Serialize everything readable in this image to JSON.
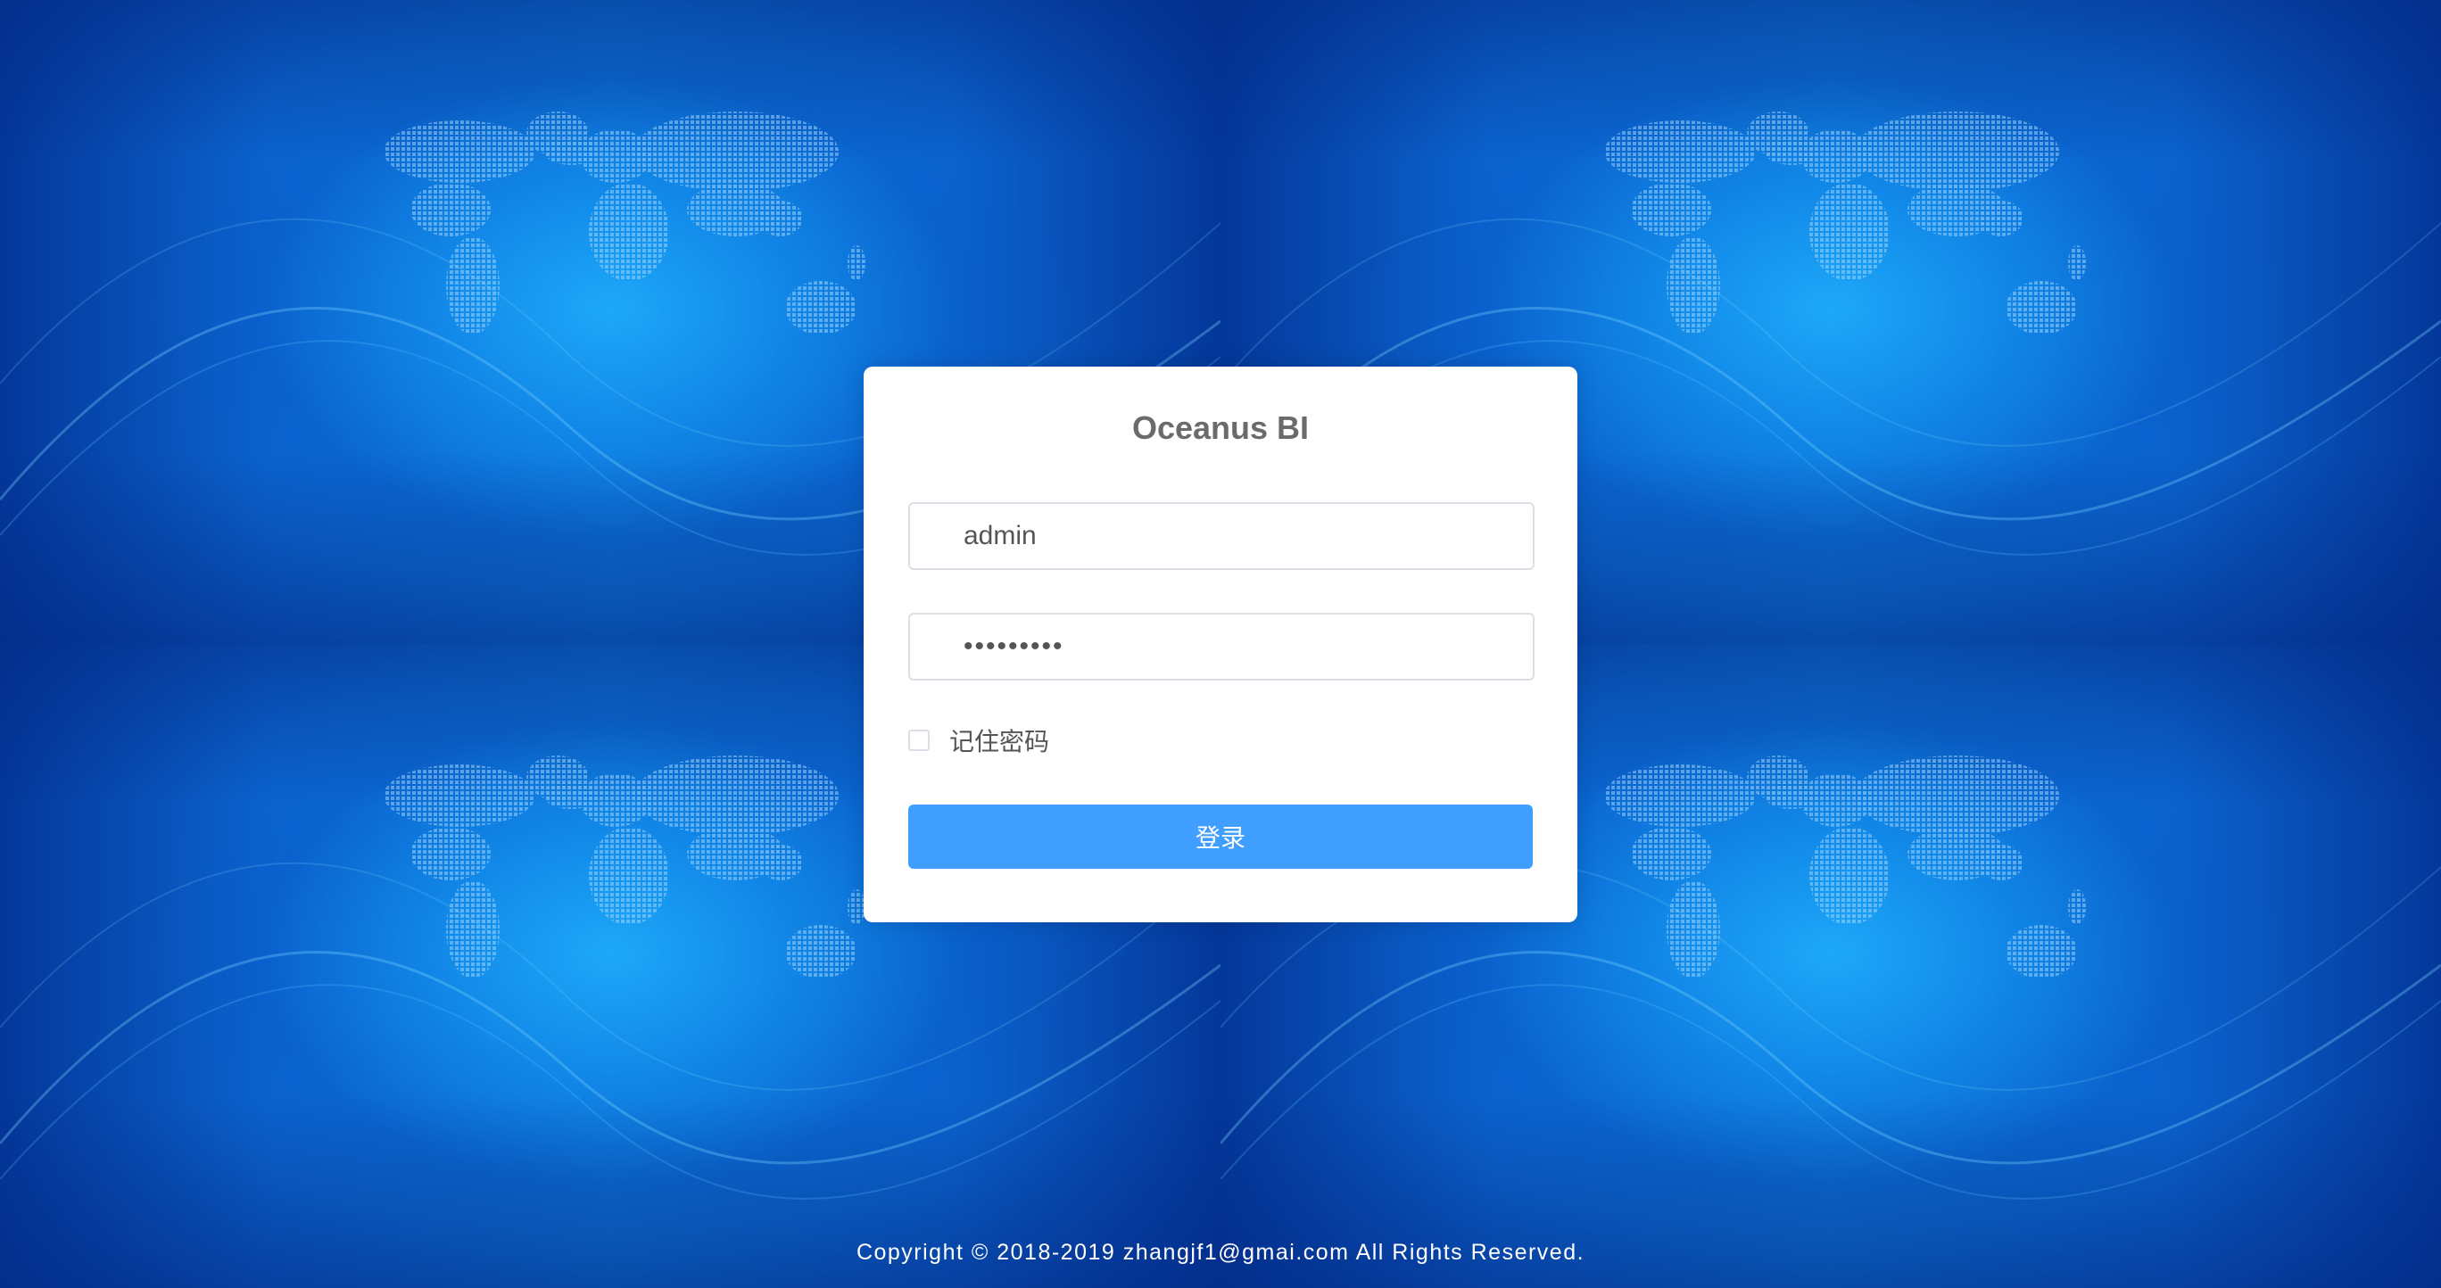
{
  "app": {
    "title": "Oceanus BI"
  },
  "login": {
    "username_value": "admin",
    "password_value": "123456789",
    "remember_label": "记住密码",
    "remember_checked": false,
    "submit_label": "登录"
  },
  "footer": {
    "copyright": "Copyright © 2018-2019 zhangjf1@gmai.com All Rights Reserved."
  },
  "colors": {
    "primary_button": "#409eff",
    "background_blue": "#0a4fb8",
    "title_text": "#6b6b6b"
  }
}
